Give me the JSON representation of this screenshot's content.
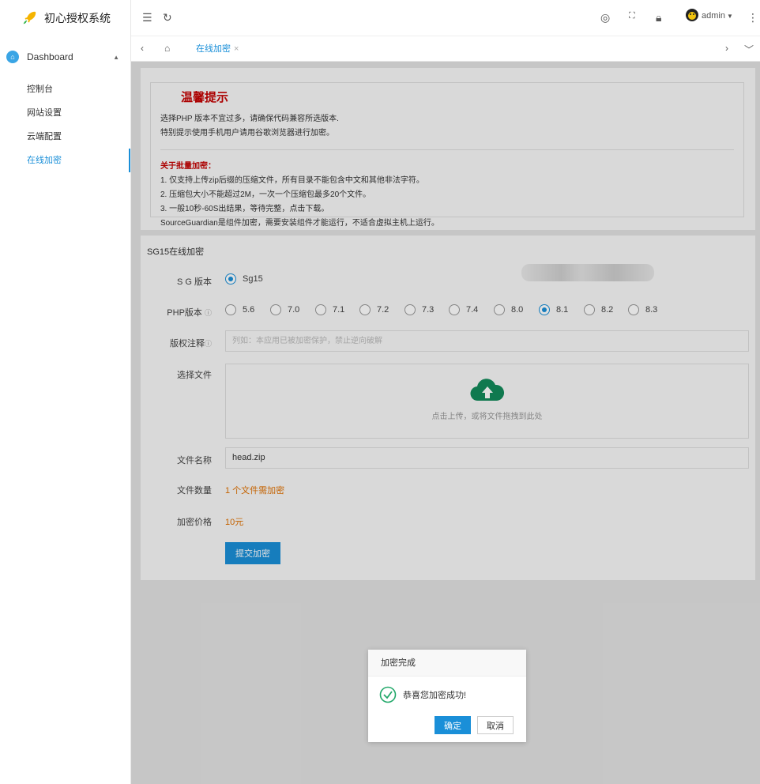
{
  "app": {
    "name": "初心授权系统"
  },
  "sidebar": {
    "menu_head": "Dashboard",
    "items": [
      {
        "label": "控制台"
      },
      {
        "label": "网站设置"
      },
      {
        "label": "云端配置"
      },
      {
        "label": "在线加密",
        "active": true
      }
    ]
  },
  "header": {
    "user": "admin"
  },
  "tabs": [
    {
      "label": "在线加密",
      "close": "×"
    }
  ],
  "notice": {
    "title": "温馨提示",
    "line1": "选择PHP 版本不宜过多，请确保代码兼容所选版本.",
    "line2": "特别提示使用手机用户请用谷歌浏览器进行加密。",
    "batch_title": "关于批量加密：",
    "batch1": "1. 仅支持上传zip后缀的压缩文件，所有目录不能包含中文和其他非法字符。",
    "batch2": "2. 压缩包大小不能超过2M，一次一个压缩包最多20个文件。",
    "batch3": "3. 一般10秒-60S出结果，等待完整，点击下载。",
    "batch4": "SourceGuardian是组件加密，需要安装组件才能运行，不适合虚拟主机上运行。"
  },
  "form": {
    "title": "SG15在线加密",
    "sg_label": "S G 版本",
    "sg_option": "Sg15",
    "php_label": "PHP版本",
    "php_versions": [
      "5.6",
      "7.0",
      "7.1",
      "7.2",
      "7.3",
      "7.4",
      "8.0",
      "8.1",
      "8.2",
      "8.3"
    ],
    "php_selected": "8.1",
    "copyright_label": "版权注释",
    "copyright_placeholder": "列如：本应用已被加密保护，禁止逆向破解",
    "file_label": "选择文件",
    "upload_hint": "点击上传，或将文件拖拽到此处",
    "filename_label": "文件名称",
    "filename_value": "head.zip",
    "count_label": "文件数量",
    "count_value": "1 个文件需加密",
    "price_label": "加密价格",
    "price_value": "10元",
    "submit_label": "提交加密"
  },
  "dialog": {
    "title": "加密完成",
    "message": "恭喜您加密成功!",
    "ok_label": "确定",
    "cancel_label": "取消"
  },
  "colors": {
    "accent": "#1a8fd8",
    "warning_red": "#c40000",
    "orange": "#e07000",
    "success": "#22a86a"
  }
}
